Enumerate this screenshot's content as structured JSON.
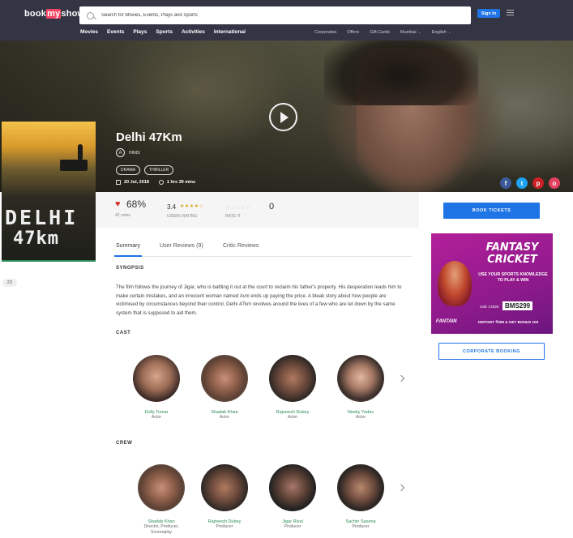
{
  "header": {
    "logo_book": "book",
    "logo_my": "my",
    "logo_show": "show",
    "search_placeholder": "Search for Movies, Events, Plays and Sports",
    "signin_label": "Sign In",
    "nav": [
      "Movies",
      "Events",
      "Plays",
      "Sports",
      "Activities",
      "International"
    ],
    "subnav": [
      "Corporates",
      "Offers",
      "Gift Cards",
      "Mumbai",
      "English"
    ]
  },
  "movie": {
    "title": "Delhi 47Km",
    "language_icon": "A",
    "language": "HINDI",
    "genres": [
      "DRAMA",
      "THRILLER"
    ],
    "release_date": "20 Jul, 2018",
    "duration": "1 hrs 39 mins",
    "poster_line1": "DELHI",
    "poster_line2": "47km",
    "format_tag": "2D"
  },
  "ratings": {
    "percent": "68%",
    "votes": "42 votes",
    "user_score": "3.4",
    "user_stars": "★★★★☆",
    "user_rating_label": "USERS RATING",
    "rate_it_stars": "☆☆☆☆☆",
    "rate_it_label": "RATE IT",
    "rate_count": "0"
  },
  "actions": {
    "book_tickets": "BOOK TICKETS",
    "corporate_booking": "CORPORATE BOOKING"
  },
  "tabs": [
    "Summary",
    "User Reviews (9)",
    "Critic Reviews"
  ],
  "synopsis": {
    "heading": "SYNOPSIS",
    "text": "The film follows the journey of Jigar, who is battling it out at the court to reclaim his father's property. His desperation leads him to make certain mistakes, and an innocent woman named Avni ends up paying the price. A bleak story about how people are victimised by circumstances beyond their control, Delhi 47km revolves around the lives of a few who are let down by the same system that is supposed to aid them."
  },
  "cast": {
    "heading": "CAST",
    "people": [
      {
        "name": "Dolly Tomar",
        "role": "Actor"
      },
      {
        "name": "Shadab Khan",
        "role": "Actor"
      },
      {
        "name": "Rajneesh Dubey",
        "role": "Actor"
      },
      {
        "name": "Neeky Yadav",
        "role": "Actor"
      }
    ]
  },
  "crew": {
    "heading": "CREW",
    "people": [
      {
        "name": "Shadab Khan",
        "role": "Director, Producer,",
        "role2": "Screenplay"
      },
      {
        "name": "Rajneesh Dubey",
        "role": "Producer",
        "role2": ""
      },
      {
        "name": "Jigar Rival",
        "role": "Producer",
        "role2": ""
      },
      {
        "name": "Sachin Saxena",
        "role": "Producer",
        "role2": ""
      }
    ]
  },
  "ad": {
    "headline1": "FANTASY",
    "headline2": "CRICKET",
    "tagline": "USE YOUR SPORTS KNOWLEDGE TO PLAY & WIN",
    "use_code": "USE CODE",
    "code": "BMS299",
    "brand": "FANTAIN",
    "deposit": "DEPOSIT ₹299 & GET BONUS 100"
  },
  "social": [
    "f",
    "t",
    "p",
    "o"
  ],
  "colors": {
    "header_bg": "#333545",
    "accent_blue": "#1f74e6",
    "brand_red": "#f84464",
    "name_green": "#2a8c58",
    "heart_red": "#d32f2f",
    "ad_purple": "#a01c93"
  }
}
